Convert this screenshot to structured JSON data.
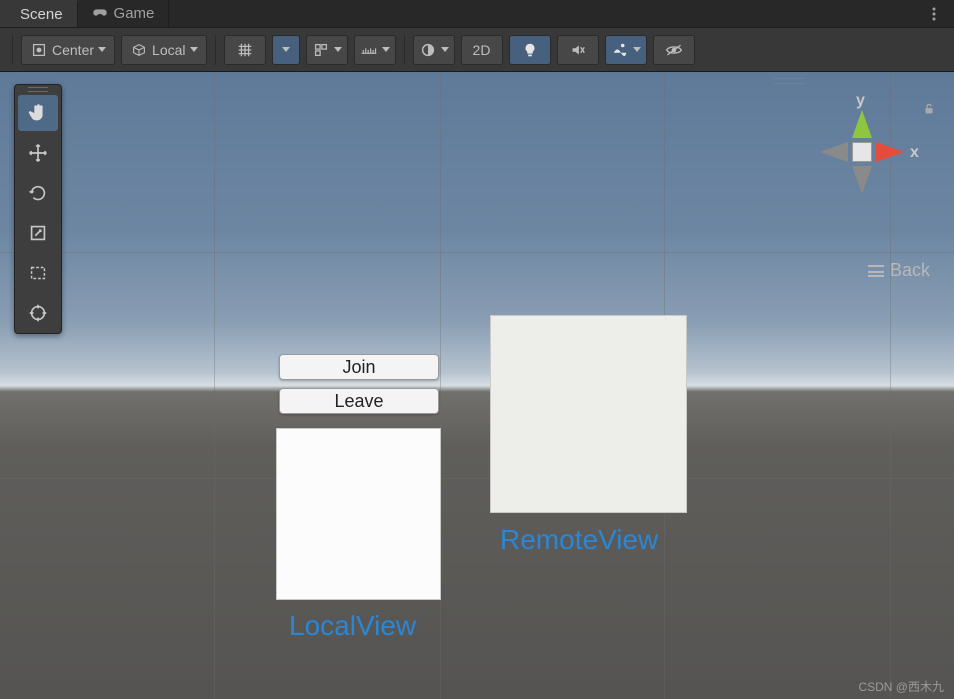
{
  "tabs": {
    "scene": "Scene",
    "game": "Game"
  },
  "toolbar": {
    "pivot_mode": "Center",
    "handle_space": "Local",
    "mode_2d": "2D"
  },
  "scene": {
    "buttons": {
      "join": "Join",
      "leave": "Leave"
    },
    "labels": {
      "local_view": "LocalView",
      "remote_view": "RemoteView"
    }
  },
  "gizmo": {
    "axis_x": "x",
    "axis_y": "y",
    "back_label": "Back"
  },
  "watermark": "CSDN @西木九"
}
